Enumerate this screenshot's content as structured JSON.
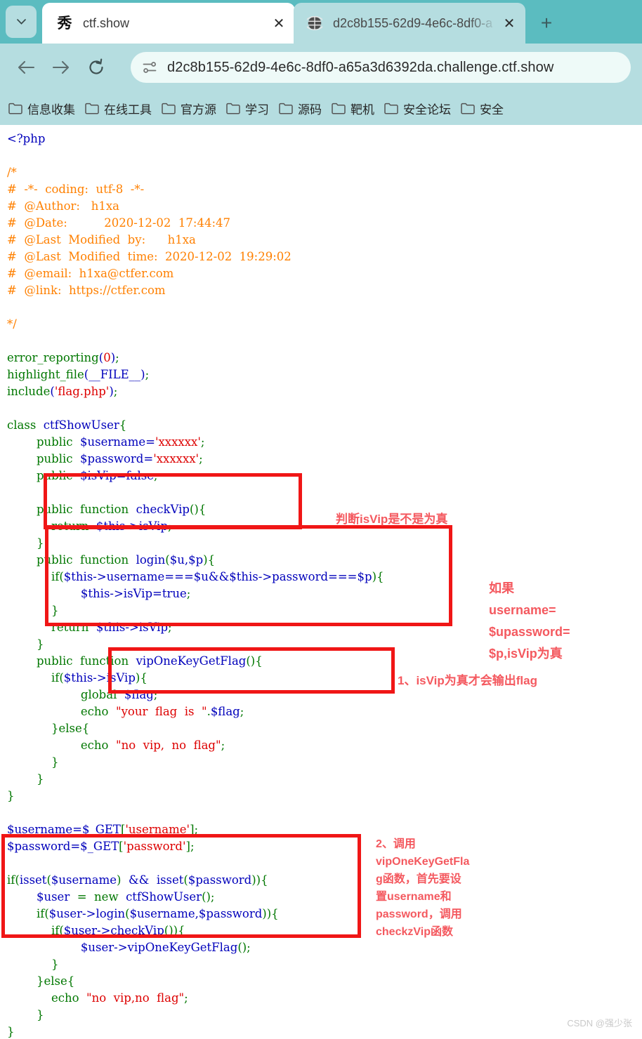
{
  "browser": {
    "tab_list_icon": "chevron-down-icon",
    "new_tab_label": "+",
    "tabs": [
      {
        "favicon_glyph": "秀",
        "title": "ctf.show",
        "close_label": "✕",
        "active": false
      },
      {
        "favicon_glyph": "globe-icon",
        "title": "d2c8b155-62d9-4e6c-8df0-a",
        "close_label": "✕",
        "active": true
      }
    ],
    "toolbar": {
      "back_label": "back-icon",
      "forward_label": "forward-icon",
      "reload_label": "reload-icon",
      "site_info_label": "site-info-icon",
      "url": "d2c8b155-62d9-4e6c-8df0-a65a3d6392da.challenge.ctf.show"
    },
    "bookmarks": [
      {
        "label": "信息收集"
      },
      {
        "label": "在线工具"
      },
      {
        "label": "官方源"
      },
      {
        "label": "学习"
      },
      {
        "label": "源码"
      },
      {
        "label": "靶机"
      },
      {
        "label": "安全论坛"
      },
      {
        "label": "安全"
      }
    ]
  },
  "colors": {
    "tabstrip": "#5bbcc0",
    "toolbar": "#b5dde0",
    "omnibox": "#eefaf8",
    "annotation_red": "#f4595f",
    "box_red": "#f01616",
    "php_keyword": "#007700",
    "php_string": "#DD0000",
    "php_default": "#0000BB",
    "php_comment": "#FF8000"
  },
  "code": {
    "open_tag": "<?php",
    "comment_block": [
      "/*",
      "#  -*-  coding:  utf-8  -*-",
      "#  @Author:   h1xa",
      "#  @Date:          2020-12-02  17:44:47",
      "#  @Last  Modified  by:      h1xa",
      "#  @Last  Modified  time:  2020-12-02  19:29:02",
      "#  @email:  h1xa@ctfer.com",
      "#  @link:  https://ctfer.com",
      "",
      "*/"
    ],
    "lines": [
      "error_reporting(0);",
      "highlight_file(__FILE__);",
      "include('flag.php');",
      "",
      "class  ctfShowUser{",
      "        public  $username='xxxxxx';",
      "        public  $password='xxxxxx';",
      "        public  $isVip=false;",
      "",
      "        public  function  checkVip(){",
      "            return  $this->isVip;",
      "        }",
      "        public  function  login($u,$p){",
      "            if($this->username===$u&&$this->password===$p){",
      "                    $this->isVip=true;",
      "            }",
      "            return  $this->isVip;",
      "        }",
      "        public  function  vipOneKeyGetFlag(){",
      "            if($this->isVip){",
      "                    global  $flag;",
      "                    echo  \"your  flag  is  \".$flag;",
      "            }else{",
      "                    echo  \"no  vip,  no  flag\";",
      "            }",
      "        }",
      "}",
      "",
      "$username=$_GET['username'];",
      "$password=$_GET['password'];",
      "",
      "if(isset($username)  &&  isset($password)){",
      "        $user  =  new  ctfShowUser();",
      "        if($user->login($username,$password)){",
      "            if($user->checkVip()){",
      "                    $user->vipOneKeyGetFlag();",
      "            }",
      "        }else{",
      "            echo  \"no  vip,no  flag\";",
      "        }",
      "}"
    ]
  },
  "annotations": {
    "note_check_vip": "判断isVip是不是为真",
    "note_login": "如果\nusername=\n$upassword=\n$p,isVip为真",
    "note_flag_output": "1、isVip为真才会输出flag",
    "note_main_flow": "2、调用\nvipOneKeyGetFla\ng函数，首先要设\n置username和\npassword，调用\ncheckzVip函数"
  },
  "watermark": "CSDN @强少张"
}
